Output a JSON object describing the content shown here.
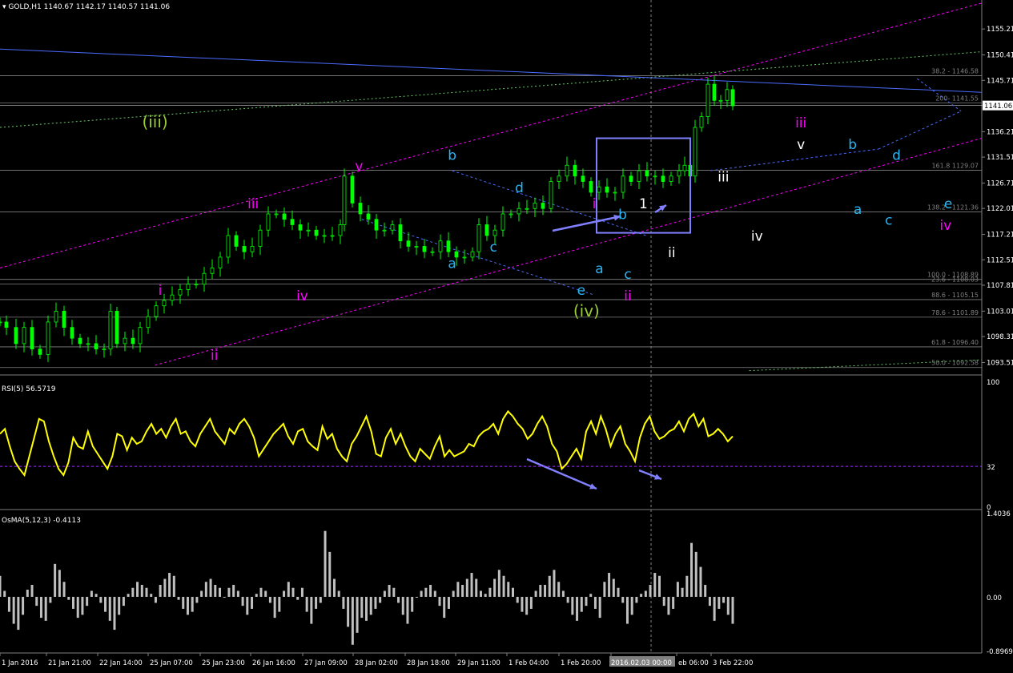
{
  "header": {
    "symbol_label": "GOLD,H1",
    "ohlc_text": "1140.67 1142.17 1140.57 1141.06"
  },
  "colors": {
    "background": "#000000",
    "candle": "#00ff00",
    "rsi": "#ffff00",
    "osma": "#c0c0c0",
    "fib_line": "#808080",
    "channel_magenta": "#ff00ff",
    "channel_green": "#66cc66",
    "trend_blue": "#4b6bff",
    "annotation_box": "#8080ff",
    "wave_cyan": "#29b6f6",
    "wave_magenta": "#ff00ff",
    "wave_white": "#ffffff",
    "wave_olive": "#9acd32",
    "price_tag_bg": "#ffffff"
  },
  "chart_data": [
    {
      "type": "line",
      "title": "GOLD,H1",
      "note": "candlestick price chart",
      "ylim": [
        1091.5,
        1158.5
      ],
      "y_ticks": [
        "1155.21",
        "1150.41",
        "1145.71",
        "1141.06",
        "1136.21",
        "1131.51",
        "1126.71",
        "1122.01",
        "1117.21",
        "1112.51",
        "1107.81",
        "1103.01",
        "1098.31",
        "1093.51"
      ],
      "current_price": "1141.06",
      "price_path": [
        [
          0,
          1101
        ],
        [
          8,
          1100
        ],
        [
          20,
          1097
        ],
        [
          30,
          1100
        ],
        [
          40,
          1096
        ],
        [
          50,
          1095
        ],
        [
          60,
          1101
        ],
        [
          70,
          1103
        ],
        [
          80,
          1100
        ],
        [
          90,
          1098
        ],
        [
          100,
          1097
        ],
        [
          110,
          1097
        ],
        [
          120,
          1096
        ],
        [
          130,
          1096
        ],
        [
          138,
          1103
        ],
        [
          146,
          1097
        ],
        [
          156,
          1098
        ],
        [
          166,
          1097
        ],
        [
          175,
          1100
        ],
        [
          185,
          1102
        ],
        [
          195,
          1104
        ],
        [
          205,
          1105
        ],
        [
          215,
          1106
        ],
        [
          225,
          1107
        ],
        [
          235,
          1108
        ],
        [
          245,
          1108
        ],
        [
          255,
          1110
        ],
        [
          265,
          1111
        ],
        [
          275,
          1113
        ],
        [
          285,
          1117
        ],
        [
          295,
          1115
        ],
        [
          305,
          1114
        ],
        [
          315,
          1115
        ],
        [
          325,
          1118
        ],
        [
          335,
          1121
        ],
        [
          345,
          1121
        ],
        [
          355,
          1120
        ],
        [
          365,
          1119
        ],
        [
          375,
          1118
        ],
        [
          385,
          1118
        ],
        [
          395,
          1117
        ],
        [
          405,
          1117
        ],
        [
          415,
          1117
        ],
        [
          425,
          1119
        ],
        [
          430,
          1128
        ],
        [
          440,
          1123
        ],
        [
          450,
          1121
        ],
        [
          460,
          1120
        ],
        [
          470,
          1118
        ],
        [
          480,
          1118
        ],
        [
          490,
          1119
        ],
        [
          500,
          1116
        ],
        [
          510,
          1115
        ],
        [
          520,
          1115
        ],
        [
          530,
          1114
        ],
        [
          540,
          1114
        ],
        [
          550,
          1116
        ],
        [
          560,
          1114
        ],
        [
          570,
          1113
        ],
        [
          580,
          1113
        ],
        [
          590,
          1114
        ],
        [
          598,
          1119
        ],
        [
          608,
          1117
        ],
        [
          618,
          1118
        ],
        [
          628,
          1121
        ],
        [
          638,
          1121
        ],
        [
          648,
          1122
        ],
        [
          658,
          1122
        ],
        [
          668,
          1123
        ],
        [
          678,
          1122
        ],
        [
          688,
          1127
        ],
        [
          698,
          1128
        ],
        [
          708,
          1130
        ],
        [
          718,
          1128
        ],
        [
          728,
          1127
        ],
        [
          738,
          1125
        ],
        [
          748,
          1126
        ],
        [
          758,
          1125
        ],
        [
          768,
          1125
        ],
        [
          778,
          1128
        ],
        [
          788,
          1127
        ],
        [
          798,
          1129
        ],
        [
          808,
          1128
        ],
        [
          818,
          1128
        ],
        [
          828,
          1127
        ],
        [
          838,
          1128
        ],
        [
          848,
          1129
        ],
        [
          855,
          1130
        ],
        [
          862,
          1128
        ],
        [
          868,
          1137
        ],
        [
          876,
          1139
        ],
        [
          884,
          1145
        ],
        [
          892,
          1142
        ],
        [
          900,
          1142
        ],
        [
          908,
          1144
        ],
        [
          915,
          1141
        ]
      ],
      "levels": [
        {
          "label": "38.2 - 1146.58",
          "value": 1146.58
        },
        {
          "label": "200- 1141.55",
          "value": 1141.55
        },
        {
          "label": "161.8 1129.07",
          "value": 1129.07
        },
        {
          "label": "138.2 - 1121.36",
          "value": 1121.36
        },
        {
          "label": "100.0 - 1108.89",
          "value": 1108.89
        },
        {
          "label": "23.6 - 1108.03",
          "value": 1108.03
        },
        {
          "label": "88.6 - 1105.15",
          "value": 1105.15
        },
        {
          "label": "78.6 - 1101.89",
          "value": 1101.89
        },
        {
          "label": "61.8 - 1096.40",
          "value": 1096.4
        },
        {
          "label": "50.0 - 1092.58",
          "value": 1092.58
        }
      ],
      "wave_labels": [
        {
          "text": "(iii)",
          "color": "olive",
          "x": 60,
          "y": 1137
        },
        {
          "text": "(iv)",
          "color": "olive",
          "x": 227,
          "y": 1102
        },
        {
          "text": "i",
          "color": "magenta",
          "x": 62,
          "y": 1106
        },
        {
          "text": "ii",
          "color": "magenta",
          "x": 83,
          "y": 1094
        },
        {
          "text": "iii",
          "color": "magenta",
          "x": 98,
          "y": 1122
        },
        {
          "text": "iv",
          "color": "magenta",
          "x": 117,
          "y": 1105
        },
        {
          "text": "v",
          "color": "magenta",
          "x": 139,
          "y": 1129
        },
        {
          "text": "b",
          "color": "cyan",
          "x": 175,
          "y": 1131
        },
        {
          "text": "d",
          "color": "cyan",
          "x": 201,
          "y": 1125
        },
        {
          "text": "c",
          "color": "cyan",
          "x": 191,
          "y": 1114
        },
        {
          "text": "a",
          "color": "cyan",
          "x": 175,
          "y": 1111
        },
        {
          "text": "e",
          "color": "cyan",
          "x": 225,
          "y": 1106
        },
        {
          "text": "a",
          "color": "cyan",
          "x": 232,
          "y": 1110
        },
        {
          "text": "c",
          "color": "cyan",
          "x": 243,
          "y": 1109
        },
        {
          "text": "i",
          "color": "magenta",
          "x": 230,
          "y": 1122
        },
        {
          "text": "ii",
          "color": "magenta",
          "x": 243,
          "y": 1105
        },
        {
          "text": "b",
          "color": "cyan",
          "x": 241,
          "y": 1120
        },
        {
          "text": "1",
          "color": "white",
          "x": 249,
          "y": 1122
        },
        {
          "text": "ii",
          "color": "white",
          "x": 260,
          "y": 1113
        },
        {
          "text": "iii",
          "color": "white",
          "x": 280,
          "y": 1127
        },
        {
          "text": "iv",
          "color": "white",
          "x": 293,
          "y": 1116
        },
        {
          "text": "v",
          "color": "white",
          "x": 310,
          "y": 1133
        },
        {
          "text": "iii",
          "color": "magenta",
          "x": 310,
          "y": 1137
        },
        {
          "text": "b",
          "color": "cyan",
          "x": 330,
          "y": 1133
        },
        {
          "text": "d",
          "color": "cyan",
          "x": 347,
          "y": 1131
        },
        {
          "text": "a",
          "color": "cyan",
          "x": 332,
          "y": 1121
        },
        {
          "text": "c",
          "color": "cyan",
          "x": 344,
          "y": 1119
        },
        {
          "text": "e",
          "color": "cyan",
          "x": 367,
          "y": 1122
        },
        {
          "text": "iv",
          "color": "magenta",
          "x": 366,
          "y": 1118
        }
      ]
    },
    {
      "type": "line",
      "title": "RSI(5) 56.5719",
      "ylim": [
        0,
        100
      ],
      "y_ticks": [
        "100",
        "32",
        "0"
      ],
      "level": 32,
      "values": [
        58,
        62,
        48,
        36,
        30,
        25,
        40,
        55,
        70,
        68,
        52,
        40,
        30,
        25,
        35,
        55,
        48,
        46,
        60,
        48,
        42,
        36,
        30,
        40,
        58,
        56,
        45,
        55,
        50,
        52,
        60,
        66,
        58,
        62,
        55,
        64,
        70,
        58,
        60,
        52,
        48,
        58,
        64,
        70,
        60,
        55,
        50,
        62,
        58,
        66,
        70,
        64,
        55,
        40,
        46,
        52,
        58,
        62,
        66,
        56,
        50,
        60,
        62,
        52,
        48,
        45,
        64,
        54,
        58,
        46,
        40,
        36,
        50,
        56,
        64,
        72,
        60,
        42,
        40,
        55,
        62,
        50,
        58,
        48,
        40,
        36,
        46,
        42,
        38,
        48,
        56,
        40,
        45,
        40,
        42,
        44,
        50,
        48,
        56,
        60,
        62,
        66,
        58,
        70,
        76,
        72,
        66,
        62,
        54,
        58,
        66,
        72,
        64,
        50,
        44,
        30,
        34,
        40,
        46,
        38,
        60,
        68,
        58,
        72,
        62,
        48,
        58,
        64,
        50,
        44,
        36,
        55,
        66,
        72,
        60,
        54,
        56,
        60,
        62,
        68,
        60,
        70,
        74,
        64,
        70,
        56,
        58,
        62,
        58,
        52,
        56
      ]
    },
    {
      "type": "bar",
      "title": "OsMA(5,12,3) -0.4113",
      "ylim": [
        -0.8969,
        1.4036
      ],
      "y_ticks": [
        "1.4036",
        "0.00",
        "-0.8969"
      ],
      "values": [
        0.35,
        0.1,
        -0.25,
        -0.45,
        -0.55,
        -0.3,
        0.12,
        0.2,
        -0.15,
        -0.35,
        -0.4,
        -0.1,
        0.55,
        0.45,
        0.25,
        -0.05,
        -0.2,
        -0.35,
        -0.3,
        -0.15,
        0.1,
        0.05,
        -0.1,
        -0.25,
        -0.4,
        -0.55,
        -0.3,
        -0.15,
        0.05,
        0.15,
        0.25,
        0.2,
        0.15,
        0.05,
        -0.1,
        0.2,
        0.3,
        0.4,
        0.35,
        -0.05,
        -0.2,
        -0.3,
        -0.25,
        -0.1,
        0.1,
        0.25,
        0.3,
        0.2,
        0.15,
        0.0,
        0.15,
        0.2,
        0.1,
        -0.15,
        -0.3,
        -0.2,
        0.05,
        0.15,
        0.1,
        -0.1,
        -0.35,
        -0.25,
        0.1,
        0.25,
        0.15,
        -0.05,
        0.15,
        -0.25,
        -0.45,
        -0.2,
        -0.1,
        1.1,
        0.75,
        0.3,
        0.1,
        -0.2,
        -0.5,
        -0.8,
        -0.6,
        -0.35,
        -0.4,
        -0.3,
        -0.2,
        -0.1,
        0.1,
        0.2,
        0.15,
        -0.1,
        -0.3,
        -0.45,
        -0.25,
        0.0,
        0.1,
        0.15,
        0.2,
        0.1,
        -0.15,
        -0.35,
        -0.2,
        0.1,
        0.25,
        0.2,
        0.3,
        0.4,
        0.3,
        0.1,
        0.05,
        0.15,
        0.3,
        0.45,
        0.35,
        0.25,
        0.15,
        -0.1,
        -0.25,
        -0.3,
        -0.2,
        0.1,
        0.2,
        0.2,
        0.35,
        0.45,
        0.25,
        0.1,
        -0.1,
        -0.3,
        -0.4,
        -0.25,
        -0.15,
        0.05,
        -0.2,
        -0.35,
        0.25,
        0.4,
        0.3,
        0.15,
        -0.1,
        -0.45,
        -0.3,
        -0.1,
        0.05,
        0.1,
        0.2,
        0.4,
        0.35,
        -0.15,
        -0.3,
        -0.2,
        0.25,
        0.15,
        0.35,
        0.9,
        0.75,
        0.5,
        0.2,
        -0.15,
        -0.4,
        -0.2,
        -0.1,
        -0.3,
        -0.45
      ]
    }
  ],
  "x_ticks": [
    "1 Jan 2016",
    "21 Jan 21:00",
    "22 Jan 14:00",
    "25 Jan 07:00",
    "25 Jan 23:00",
    "26 Jan 16:00",
    "27 Jan 09:00",
    "28 Jan 02:00",
    "28 Jan 18:00",
    "29 Jan 11:00",
    "1 Feb 04:00",
    "1 Feb 20:00",
    "2016.02.03 00:00",
    "eb 06:00",
    "3 Feb 22:00"
  ]
}
